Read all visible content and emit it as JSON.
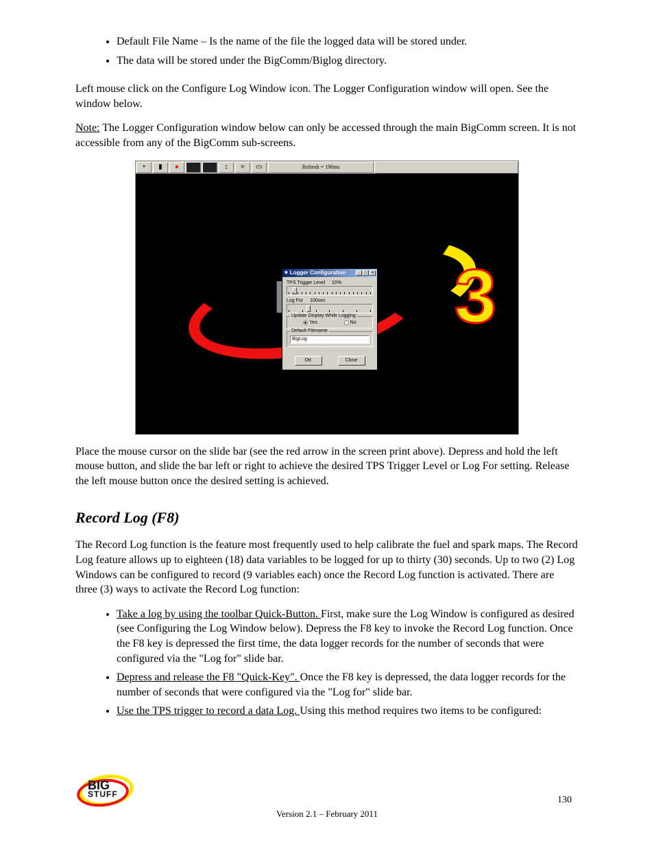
{
  "top_bullets": [
    "Default File Name – Is the name of the file the logged data will be stored under.",
    "The data will be stored under the BigComm/Biglog directory."
  ],
  "para_intro": "Left mouse click on the Configure Log Window icon. The Logger Configuration window will open. See the window below.",
  "note_label": "Note:",
  "note_body": " The Logger Configuration window below can only be accessed through the main BigComm screen. It is not accessible from any of the BigComm sub-screens.",
  "toolbar": {
    "refresh": "Refresh = 190ms"
  },
  "dialog": {
    "title": "Logger Configuration",
    "tps_label": "TPS Trigger Level",
    "tps_value": "10%",
    "logfor_label": "Log For",
    "logfor_value": "100sec",
    "group_label": "Update Display While Logging",
    "radio_yes": "Yes",
    "radio_no": "No",
    "filename_label": "Default Filename",
    "filename_value": "BigLog",
    "ok": "OK",
    "close": "Close"
  },
  "para_instructions": "Place the mouse cursor on the slide bar (see the red arrow in the screen print above). Depress and hold the left mouse button, and slide the bar left or right to achieve the desired TPS Trigger Level or Log For setting. Release the left mouse button once the desired setting is achieved.",
  "heading": "Record Log (F8)",
  "heading_italic": "Record Log (F8)",
  "record_para": "The Record Log function is the feature most frequently used to help calibrate the fuel and spark maps. The Record Log feature allows up to eighteen (18) data variables to be logged for up to thirty (30) seconds. Up to two (2) Log Windows can be configured to record (9 variables each) once the Record Log function is activated. There are three (3) ways to activate the Record Log function:",
  "record_bullets": [
    {
      "prefix": "Take a log by using the toolbar Quick-Button. ",
      "body": "First, make sure the Log Window is configured as desired (see Configuring the Log Window below). Depress the F8 key to invoke the Record Log function. Once the F8 key is depressed the first time, the data logger records for the number of seconds that were configured via the \"Log for\" slide bar."
    },
    {
      "prefix": "Depress and release the F8 \"Quick-Key\". ",
      "body": "Once the F8 key is depressed, the data logger records for the number of seconds that were configured via the \"Log for\" slide bar."
    },
    {
      "prefix": "Use the TPS trigger to record a data Log. ",
      "body": "Using this method requires two items to be configured:"
    }
  ],
  "footer": {
    "page": "130",
    "version": "Version 2.1 – February 2011"
  }
}
